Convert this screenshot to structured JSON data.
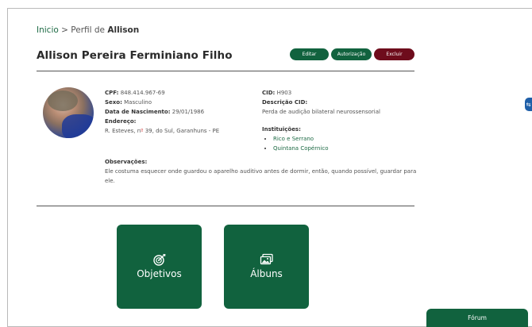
{
  "breadcrumb": {
    "home": "Inicio",
    "separator": " > ",
    "prefix": "Perfil de ",
    "current": "Allison"
  },
  "profile": {
    "name": "Allison Pereira Ferminiano Filho",
    "actions": {
      "edit": "Editar",
      "authorization": "Autorização",
      "delete": "Excluir"
    },
    "cpf_label": "CPF:",
    "cpf": " 848.414.967-69",
    "sex_label": "Sexo:",
    "sex": " Masculino",
    "birth_label": "Data de Nascimento:",
    "birth": " 29/01/1986",
    "address_label": "Endereço:",
    "address_start": "R. Esteves, n",
    "address_mark": "º",
    "address_end": " 39, do Sul, Garanhuns - PE",
    "cid_label": "CID:",
    "cid": " H903",
    "cid_desc_label": "Descrição CID:",
    "cid_desc": "Perda de audição bilateral neurossensorial",
    "institutions_label": "Instituições:",
    "institutions": [
      "Rico e Serrano",
      "Quintana Copérnico"
    ],
    "observations_label": "Observações:",
    "observations": "Ele costuma esquecer onde guardou o aparelho auditivo antes de dormir, então, quando possível, guardar para ele."
  },
  "tiles": {
    "objectives": "Objetivos",
    "albums": "Álbuns"
  },
  "forum_label": "Fórum",
  "side_tab_label": "⇆",
  "colors": {
    "primary": "#11623e",
    "danger": "#6e0c1c",
    "link": "#1e6a45"
  },
  "icons": {
    "objectives": "target-icon",
    "albums": "photo-album-icon"
  }
}
